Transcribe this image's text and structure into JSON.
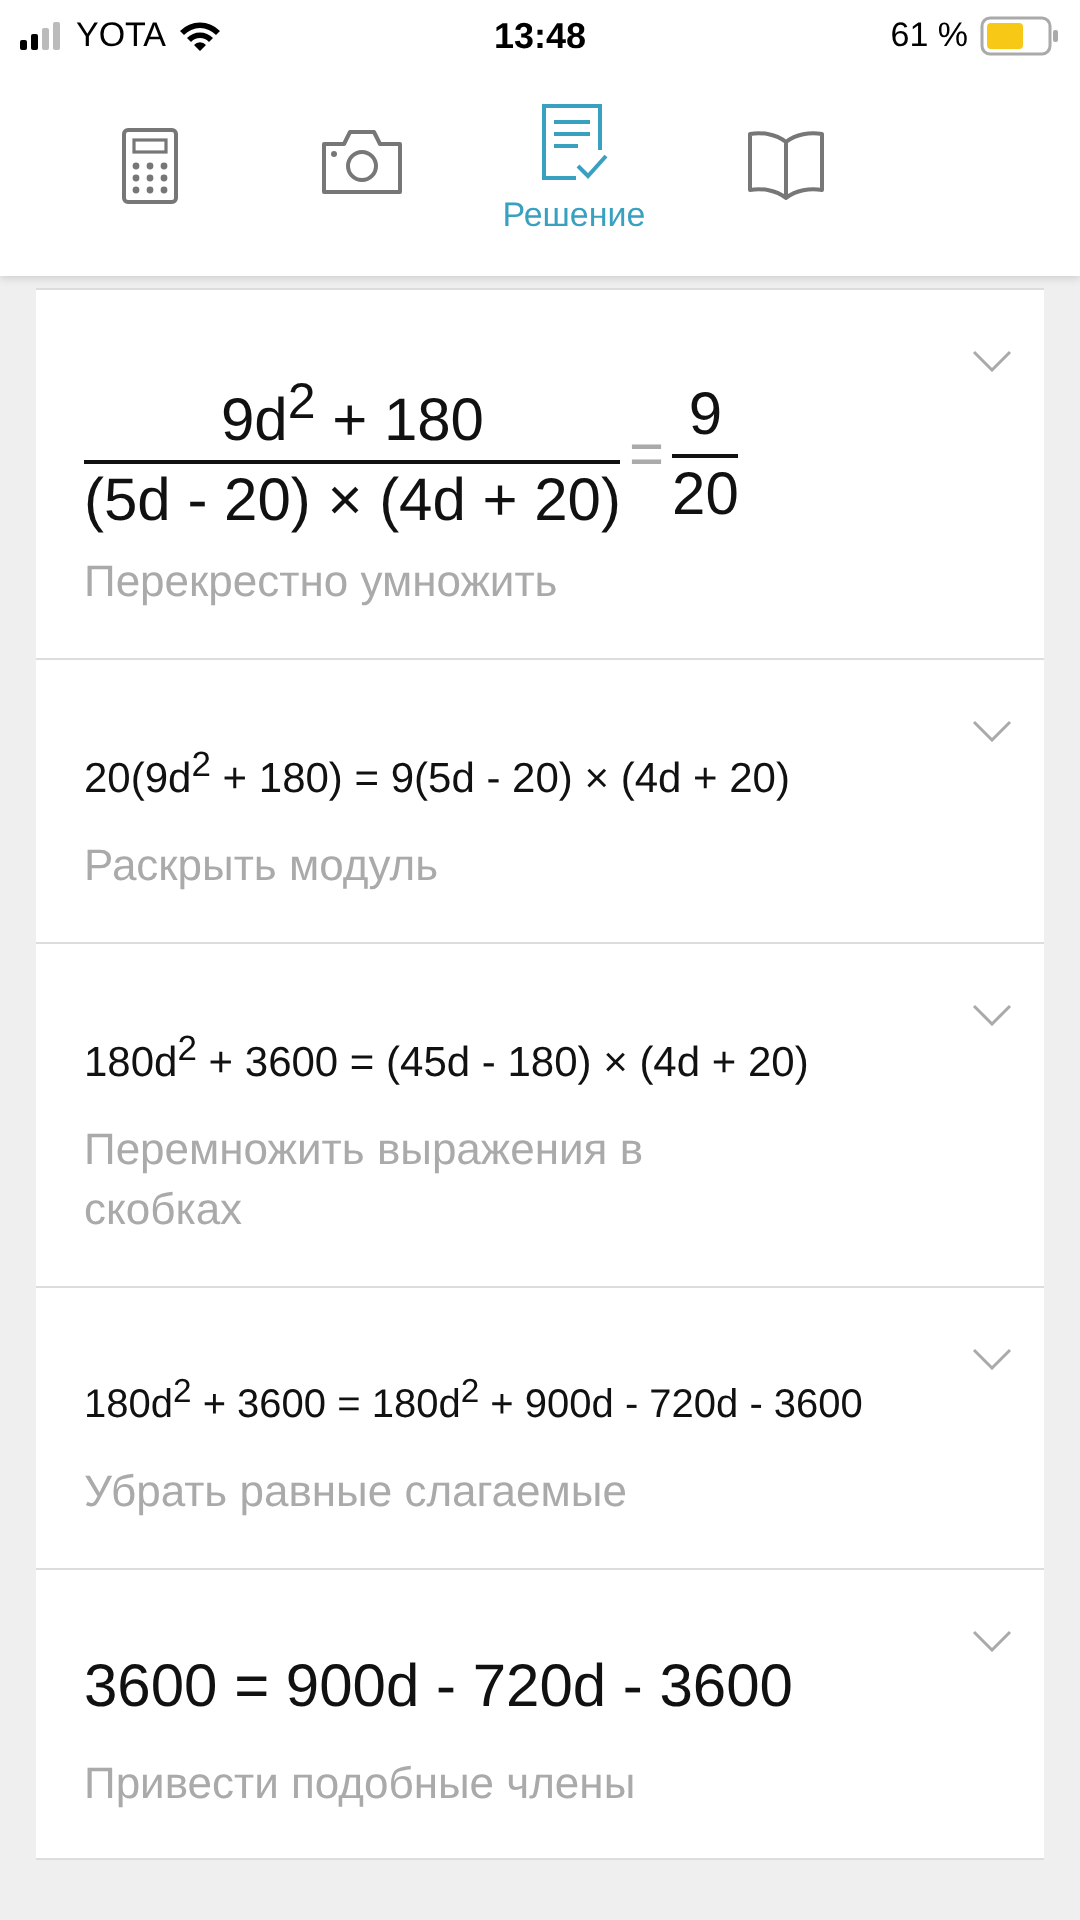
{
  "status_bar": {
    "carrier": "YOTA",
    "time": "13:48",
    "battery": "61 %"
  },
  "tabs": [
    {
      "kind": "calculator",
      "selected": false
    },
    {
      "kind": "camera",
      "selected": false
    },
    {
      "kind": "solution",
      "label": "Решение",
      "selected": true
    },
    {
      "kind": "book",
      "selected": false
    }
  ],
  "steps": [
    {
      "kind": "fraction",
      "numerator": "9d$^{2}$ + 180",
      "denominator": "(5d - 20) × (4d + 20)",
      "relation": "=",
      "rhs_numerator": "9",
      "rhs_denominator": "20",
      "description": "Перекрестно умножить",
      "expanded": false
    },
    {
      "kind": "equation",
      "formula": "20(9d$^{2}$ + 180) = 9(5d - 20) × (4d + 20)",
      "description": "Раскрыть модуль",
      "expanded": false
    },
    {
      "kind": "equation",
      "formula": "180d$^{2}$ + 3600 = (45d - 180) × (4d + 20)",
      "description": "Перемножить выражения в скобках",
      "expanded": false
    },
    {
      "kind": "equation",
      "formula": "180d$^{2}$ + 3600 = 180d$^{2}$ + 900d - 720d - 3600",
      "description": "Убрать равные слагаемые",
      "expanded": false
    },
    {
      "kind": "equation",
      "formula": "3600 = 900d - 720d - 3600",
      "description": "Привести подобные члены",
      "expanded": false
    }
  ]
}
